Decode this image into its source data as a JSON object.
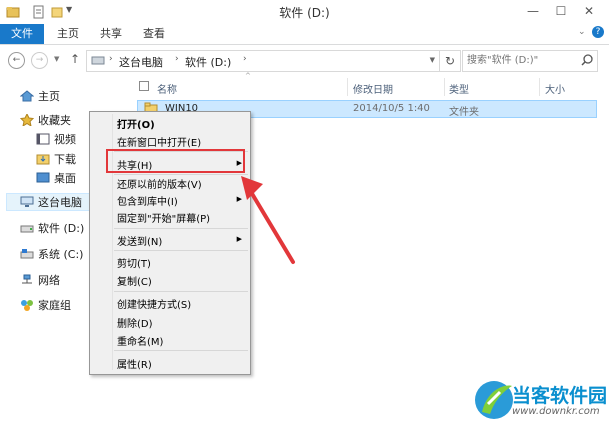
{
  "window": {
    "title": "软件 (D:)"
  },
  "ribbon": {
    "tabs": [
      "文件",
      "主页",
      "共享",
      "查看"
    ]
  },
  "address": {
    "crumbs": [
      "这台电脑",
      "软件 (D:)"
    ],
    "search_placeholder": "搜索\"软件 (D:)\""
  },
  "nav": {
    "items": [
      "主页",
      "收藏夹",
      "视频",
      "下载",
      "桌面",
      "这台电脑",
      "软件 (D:)",
      "系统 (C:)",
      "网络",
      "家庭组"
    ]
  },
  "columns": [
    "名称",
    "修改日期",
    "类型",
    "大小"
  ],
  "file_row": {
    "name": "WIN10",
    "date": "2014/10/5 1:40",
    "type": "文件夹"
  },
  "context_menu": {
    "open": "打开(O)",
    "open_new": "在新窗口中打开(E)",
    "share": "共享(H)",
    "restore": "还原以前的版本(V)",
    "include": "包含到库中(I)",
    "pin": "固定到\"开始\"屏幕(P)",
    "send_to": "发送到(N)",
    "cut": "剪切(T)",
    "copy": "复制(C)",
    "shortcut": "创建快捷方式(S)",
    "delete": "删除(D)",
    "rename": "重命名(M)",
    "properties": "属性(R)"
  },
  "watermark": {
    "brand": "当客软件园",
    "url": "www.downkr.com"
  },
  "colors": {
    "accent": "#1979ca",
    "highlight": "#e2373a",
    "selection": "#cce8ff"
  }
}
